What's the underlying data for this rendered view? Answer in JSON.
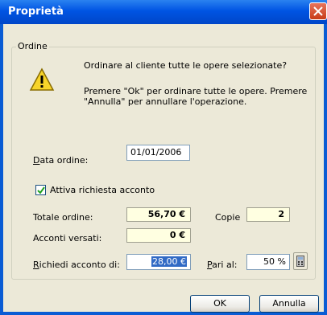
{
  "window": {
    "title": "Proprietà"
  },
  "group": {
    "label": "Ordine"
  },
  "message": {
    "line1": "Ordinare al cliente tutte le opere selezionate?",
    "line2": "Premere \"Ok\" per ordinare tutte le opere. Premere",
    "line3": "\"Annulla\" per annullare l'operazione."
  },
  "form": {
    "data_ordine_label_u": "D",
    "data_ordine_label_rest": "ata ordine:",
    "data_ordine_value": "01/01/2006",
    "checkbox_label": "Attiva richiesta acconto",
    "checkbox_checked": true,
    "totale_label": "Totale ordine:",
    "totale_value": "56,70 €",
    "copie_label": "Copie",
    "copie_value": "2",
    "acconti_label": "Acconti versati:",
    "acconti_value": "0 €",
    "richiedi_label_u": "R",
    "richiedi_label_rest": "ichiedi acconto di:",
    "richiedi_value": "28,00 €",
    "pari_label_u": "P",
    "pari_label_rest": "ari al:",
    "pari_value": "50 %"
  },
  "buttons": {
    "ok": "OK",
    "annulla": "Annulla"
  },
  "icons": {
    "warning": "warning-icon",
    "close": "close-icon",
    "calculator": "calculator-icon"
  },
  "colors": {
    "titlebar": "#0054e3",
    "client": "#ece9d8",
    "readonly_field": "#ffffe1",
    "selection": "#316ac5"
  }
}
